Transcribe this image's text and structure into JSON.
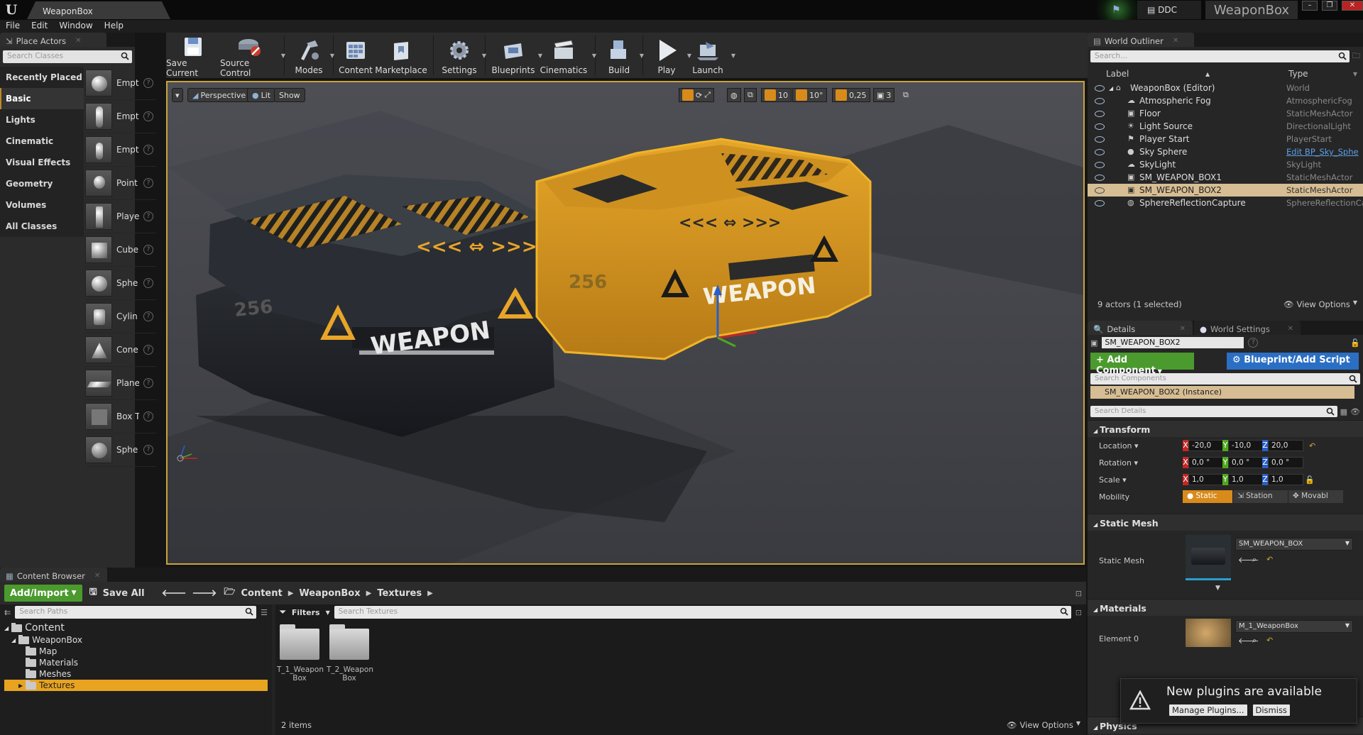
{
  "window": {
    "tab_title": "WeaponBox",
    "ddc_label": "DDC",
    "project_name": "WeaponBox"
  },
  "menu": [
    "File",
    "Edit",
    "Window",
    "Help"
  ],
  "place_actors": {
    "tab_label": "Place Actors",
    "search_placeholder": "Search Classes",
    "categories": [
      "Recently Placed",
      "Basic",
      "Lights",
      "Cinematic",
      "Visual Effects",
      "Geometry",
      "Volumes",
      "All Classes"
    ],
    "selected_category": "Basic",
    "items": [
      {
        "label": "Empt",
        "icon": "empty-actor-icon"
      },
      {
        "label": "Empt",
        "icon": "empty-character-icon"
      },
      {
        "label": "Empt",
        "icon": "empty-pawn-icon"
      },
      {
        "label": "Point",
        "icon": "point-light-icon"
      },
      {
        "label": "Playe",
        "icon": "player-start-icon"
      },
      {
        "label": "Cube",
        "icon": "cube-icon"
      },
      {
        "label": "Sphe",
        "icon": "sphere-icon"
      },
      {
        "label": "Cylin",
        "icon": "cylinder-icon"
      },
      {
        "label": "Cone",
        "icon": "cone-icon"
      },
      {
        "label": "Plane",
        "icon": "plane-icon"
      },
      {
        "label": "Box T",
        "icon": "box-trigger-icon"
      },
      {
        "label": "Sphe",
        "icon": "sphere-trigger-icon"
      }
    ]
  },
  "toolbar": {
    "buttons": [
      {
        "label": "Save Current",
        "icon": "save-icon"
      },
      {
        "label": "Source Control",
        "icon": "source-control-icon"
      },
      {
        "label": "Modes",
        "icon": "modes-icon"
      },
      {
        "label": "Content",
        "icon": "content-icon"
      },
      {
        "label": "Marketplace",
        "icon": "marketplace-icon"
      },
      {
        "label": "Settings",
        "icon": "settings-icon"
      },
      {
        "label": "Blueprints",
        "icon": "blueprints-icon"
      },
      {
        "label": "Cinematics",
        "icon": "cinematics-icon"
      },
      {
        "label": "Build",
        "icon": "build-icon"
      },
      {
        "label": "Play",
        "icon": "play-icon"
      },
      {
        "label": "Launch",
        "icon": "launch-icon"
      }
    ]
  },
  "viewport": {
    "perspective_label": "Perspective",
    "lit_label": "Lit",
    "show_label": "Show",
    "grid_snap": "10",
    "rotation_snap": "10°",
    "scale_snap": "0,25",
    "camera_speed": "3",
    "crate_text_1": "WEAPON",
    "crate_text_2": "WEAPON",
    "crate_number_1": "256",
    "crate_number_2": "256",
    "accent": "#e8a528",
    "selection_color": "#f0b429"
  },
  "content_browser": {
    "tab_label": "Content Browser",
    "add_import_label": "Add/Import",
    "save_all_label": "Save All",
    "breadcrumb": [
      "Content",
      "WeaponBox",
      "Textures"
    ],
    "search_paths_placeholder": "Search Paths",
    "filters_label": "Filters",
    "search_textures_placeholder": "Search Textures",
    "tree": [
      {
        "label": "Content",
        "level": 0
      },
      {
        "label": "WeaponBox",
        "level": 1
      },
      {
        "label": "Map",
        "level": 2
      },
      {
        "label": "Materials",
        "level": 2
      },
      {
        "label": "Meshes",
        "level": 2
      },
      {
        "label": "Textures",
        "level": 2
      }
    ],
    "assets": [
      {
        "line1": "T_1_Weapon",
        "line2": "Box"
      },
      {
        "line1": "T_2_Weapon",
        "line2": "Box"
      }
    ],
    "item_count": "2 items",
    "view_options_label": "View Options"
  },
  "outliner": {
    "tab_label": "World Outliner",
    "search_placeholder": "Search...",
    "col_label": "Label",
    "col_type": "Type",
    "rows": [
      {
        "label": "WeaponBox (Editor)",
        "type": "World"
      },
      {
        "label": "Atmospheric Fog",
        "type": "AtmosphericFog"
      },
      {
        "label": "Floor",
        "type": "StaticMeshActor"
      },
      {
        "label": "Light Source",
        "type": "DirectionalLight"
      },
      {
        "label": "Player Start",
        "type": "PlayerStart"
      },
      {
        "label": "Sky Sphere",
        "type": "Edit BP_Sky_Sphe"
      },
      {
        "label": "SkyLight",
        "type": "SkyLight"
      },
      {
        "label": "SM_WEAPON_BOX1",
        "type": "StaticMeshActor"
      },
      {
        "label": "SM_WEAPON_BOX2",
        "type": "StaticMeshActor"
      },
      {
        "label": "SphereReflectionCapture",
        "type": "SphereReflectionCa"
      }
    ],
    "selected_row": "SM_WEAPON_BOX2",
    "actor_count": "9 actors (1 selected)",
    "view_options_label": "View Options"
  },
  "details": {
    "tab_label": "Details",
    "world_settings_label": "World Settings",
    "actor_name": "SM_WEAPON_BOX2",
    "add_component_label": "+ Add Component",
    "blueprint_label": "Blueprint/Add Script",
    "search_components_placeholder": "Search Components",
    "instance_label": "SM_WEAPON_BOX2 (Instance)",
    "search_details_placeholder": "Search Details",
    "transform": {
      "section": "Transform",
      "location_label": "Location",
      "rotation_label": "Rotation",
      "scale_label": "Scale",
      "mobility_label": "Mobility",
      "location": [
        "-20,0",
        "-10,0",
        "20,0"
      ],
      "rotation": [
        "0,0 °",
        "0,0 °",
        "0,0 °"
      ],
      "scale": [
        "1,0",
        "1,0",
        "1,0"
      ],
      "mobility_options": [
        "Static",
        "Station",
        "Movabl"
      ]
    },
    "static_mesh": {
      "section": "Static Mesh",
      "label": "Static Mesh",
      "value": "SM_WEAPON_BOX"
    },
    "materials": {
      "section": "Materials",
      "element_label": "Element 0",
      "value": "M_1_WeaponBox"
    },
    "physics_section": "Physics"
  },
  "notification": {
    "title": "New plugins are available",
    "manage_label": "Manage Plugins...",
    "dismiss_label": "Dismiss"
  }
}
